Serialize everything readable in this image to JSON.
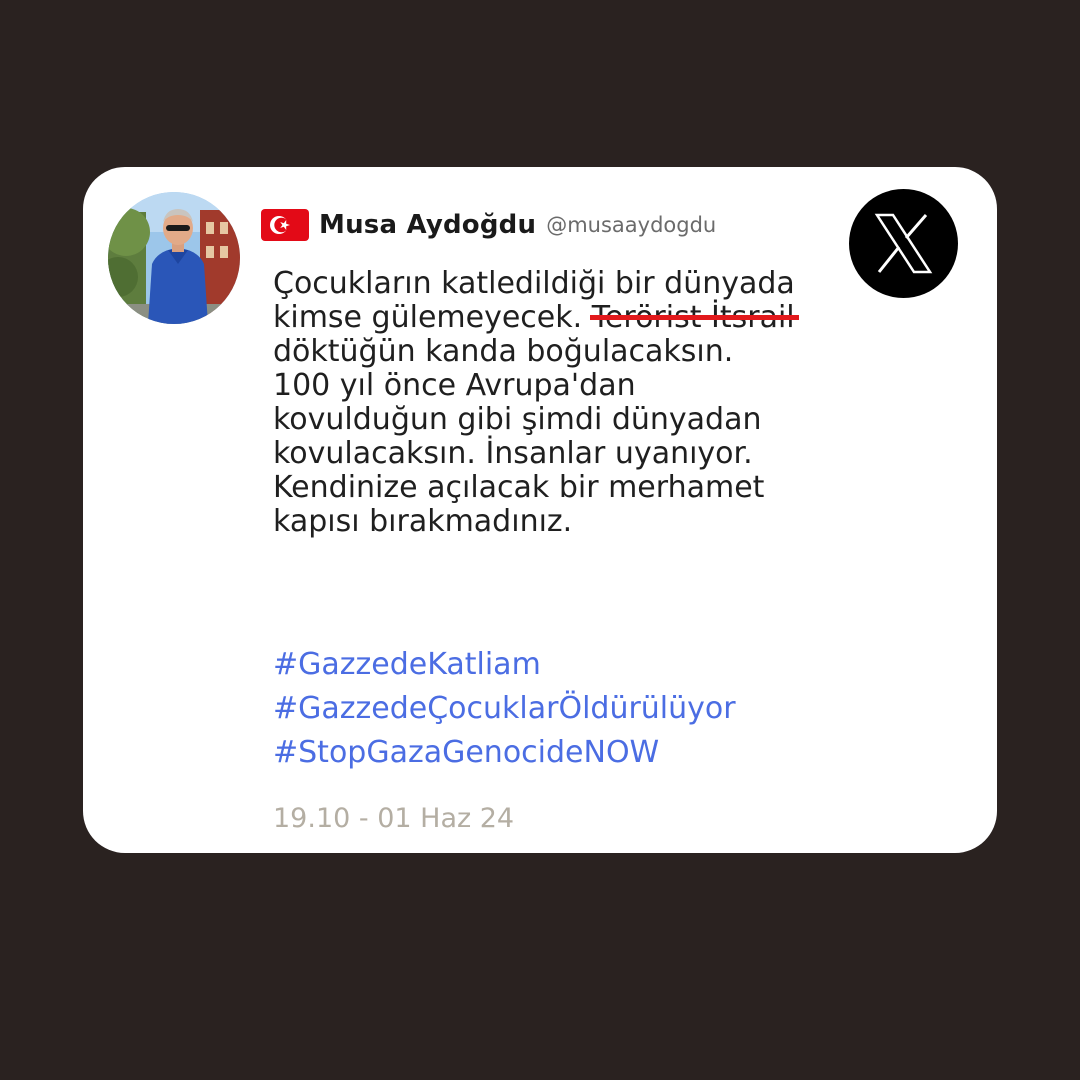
{
  "tweet": {
    "author": {
      "display_name": "Musa Aydoğdu",
      "handle": "@musaaydogdu",
      "flag_icon": "turkey-flag-icon",
      "avatar": "profile-photo"
    },
    "platform_icon": "x-logo-icon",
    "text_lines": [
      "Çocukların katledildiği bir dünyada",
      "kimse gülemeyecek.",
      "Terörist İtsrail",
      "döktüğün kanda boğulacaksın.",
      "100 yıl önce Avrupa'dan",
      "kovulduğun gibi şimdi dünyadan",
      "kovulacaksın. İnsanlar uyanıyor.",
      "Kendinize açılacak bir merhamet",
      "kapısı bırakmadınız."
    ],
    "hashtags": [
      "#GazzedeKatliam",
      "#GazzedeÇocuklarÖldürülüyor",
      "#StopGazaGenocideNOW"
    ],
    "timestamp": "19.10 - 01 Haz 24"
  },
  "colors": {
    "background": "#2a2220",
    "card": "#ffffff",
    "hashtag": "#4b6de3",
    "strikethrough": "#e2191c",
    "timestamp": "#b4aea3"
  }
}
